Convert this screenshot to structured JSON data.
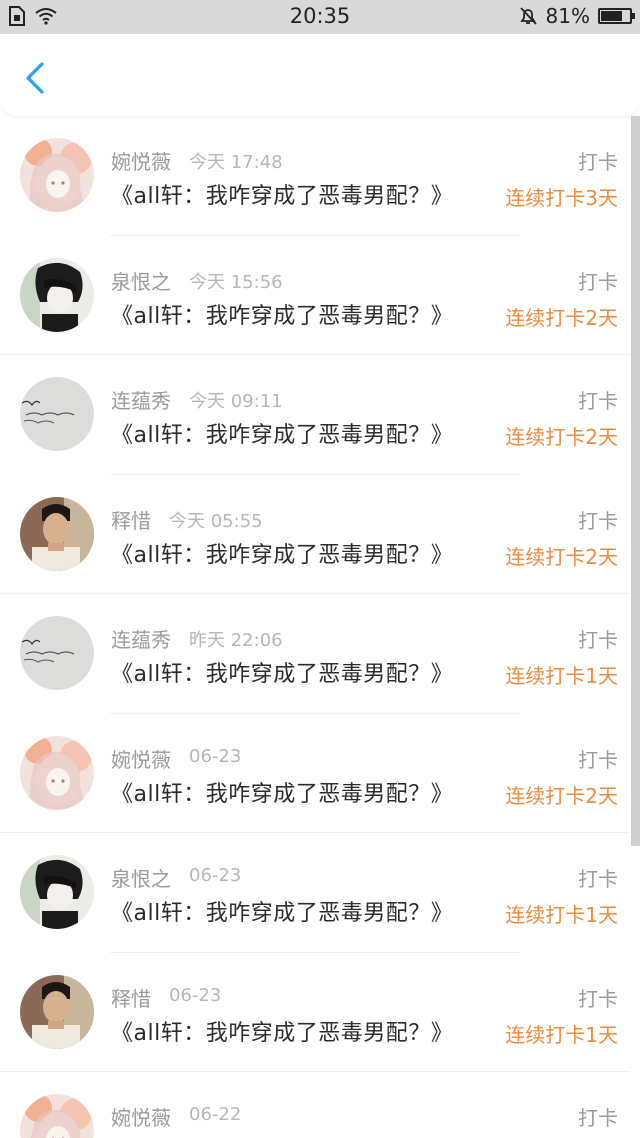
{
  "status_bar": {
    "time": "20:35",
    "battery": "81%",
    "battery_level": 0.81
  },
  "nav": {
    "back_icon": "chevron-left-icon",
    "accent": "#2aa0f0"
  },
  "colors": {
    "streak": "#f08a3c",
    "name": "#9a9a9a",
    "title": "#2b2b2b"
  },
  "rows": [
    {
      "name": "婉悦薇",
      "time": "今天 17:48",
      "book": "《all轩：我咋穿成了恶毒男配？》",
      "tag": "打卡",
      "streak": "连续打卡3天",
      "avatar": "anime-girl"
    },
    {
      "name": "泉恨之",
      "time": "今天 15:56",
      "book": "《all轩：我咋穿成了恶毒男配？》",
      "tag": "打卡",
      "streak": "连续打卡2天",
      "avatar": "dark-hair-boy"
    },
    {
      "name": "连蕴秀",
      "time": "今天 09:11",
      "book": "《all轩：我咋穿成了恶毒男配？》",
      "tag": "打卡",
      "streak": "连续打卡2天",
      "avatar": "handwriting"
    },
    {
      "name": "释惜",
      "time": "今天 05:55",
      "book": "《all轩：我咋穿成了恶毒男配？》",
      "tag": "打卡",
      "streak": "连续打卡2天",
      "avatar": "photo-man"
    },
    {
      "name": "连蕴秀",
      "time": "昨天 22:06",
      "book": "《all轩：我咋穿成了恶毒男配？》",
      "tag": "打卡",
      "streak": "连续打卡1天",
      "avatar": "handwriting"
    },
    {
      "name": "婉悦薇",
      "time": "06-23",
      "book": "《all轩：我咋穿成了恶毒男配？》",
      "tag": "打卡",
      "streak": "连续打卡2天",
      "avatar": "anime-girl"
    },
    {
      "name": "泉恨之",
      "time": "06-23",
      "book": "《all轩：我咋穿成了恶毒男配？》",
      "tag": "打卡",
      "streak": "连续打卡1天",
      "avatar": "dark-hair-boy"
    },
    {
      "name": "释惜",
      "time": "06-23",
      "book": "《all轩：我咋穿成了恶毒男配？》",
      "tag": "打卡",
      "streak": "连续打卡1天",
      "avatar": "photo-man"
    },
    {
      "name": "婉悦薇",
      "time": "06-22",
      "book": "",
      "tag": "打卡",
      "streak": "",
      "avatar": "anime-girl"
    }
  ]
}
